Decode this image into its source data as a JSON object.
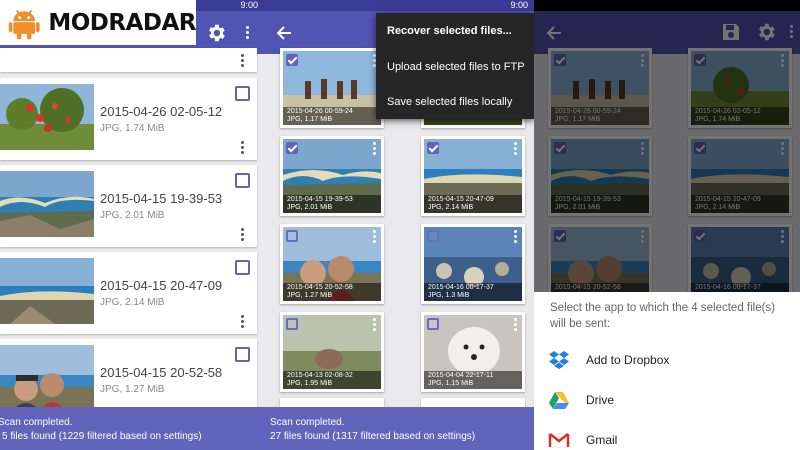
{
  "logo": {
    "text": "MODRADAR"
  },
  "statusbar": {
    "time": "9:00"
  },
  "panel1": {
    "cards": [
      {
        "title": "2015-04-26 02-05-12",
        "subtitle": "JPG, 1.74 MiB"
      },
      {
        "title": "2015-04-15 19-39-53",
        "subtitle": "JPG, 2.01 MiB"
      },
      {
        "title": "2015-04-15 20-47-09",
        "subtitle": "JPG, 2.14 MiB"
      },
      {
        "title": "2015-04-15 20-52-58",
        "subtitle": "JPG, 1.27 MiB"
      }
    ],
    "footer": {
      "line1": "Scan completed.",
      "line2": "5 files found (1229 filtered based on settings)"
    }
  },
  "panel2": {
    "menu": {
      "recover": "Recover selected files...",
      "upload": "Upload selected files to FTP",
      "save": "Save selected files locally"
    },
    "tiles": [
      {
        "caption1": "2015-04-26 00-59-24",
        "caption2": "JPG, 1.17 MiB",
        "checked": true
      },
      {
        "caption1": "",
        "caption2": "JPG, 1.74 MiB",
        "checked": false
      },
      {
        "caption1": "2015-04-15 19-39-53",
        "caption2": "JPG, 2.01 MiB",
        "checked": true
      },
      {
        "caption1": "2015-04-15 20-47-09",
        "caption2": "JPG, 2.14 MiB",
        "checked": true
      },
      {
        "caption1": "2015-04-15 20-52-58",
        "caption2": "JPG, 1.27 MiB",
        "checked": false
      },
      {
        "caption1": "2015-04-16 00-17-37",
        "caption2": "JPG, 1.3 MiB",
        "checked": false
      },
      {
        "caption1": "2015-04-13 02-08-32",
        "caption2": "JPG, 1.95 MiB",
        "checked": false
      },
      {
        "caption1": "2015-04-04 22-17-11",
        "caption2": "JPG, 1.15 MiB",
        "checked": false
      }
    ],
    "footer": {
      "line1": "Scan completed.",
      "line2": "27 files found (1317 filtered based on settings)"
    }
  },
  "panel3": {
    "tiles": [
      {
        "caption1": "2015-04-26 00-59-24",
        "caption2": "JPG, 1.17 MiB"
      },
      {
        "caption1": "2015-04-26 02-05-12",
        "caption2": "JPG, 1.74 MiB"
      },
      {
        "caption1": "2015-04-15 19-39-53",
        "caption2": "JPG, 2.01 MiB"
      },
      {
        "caption1": "2015-04-15 20-47-09",
        "caption2": "JPG, 2.14 MiB"
      },
      {
        "caption1": "2015-04-15 20-52-58",
        "caption2": "JPG, 1.27 MiB"
      },
      {
        "caption1": "2015-04-16 00-17-37",
        "caption2": "JPG, 1.3 MiB"
      }
    ],
    "sheet": {
      "prompt": "Select the app to which the 4 selected file(s) will be sent:",
      "apps": [
        {
          "label": "Add to Dropbox",
          "icon": "dropbox-icon"
        },
        {
          "label": "Drive",
          "icon": "drive-icon"
        },
        {
          "label": "Gmail",
          "icon": "gmail-icon"
        }
      ]
    }
  },
  "colors": {
    "appbar": "#5054b3",
    "statusbar": "#3b3b96",
    "footer": "#6264bb",
    "accent": "#6163b8",
    "menu": "#262626"
  }
}
